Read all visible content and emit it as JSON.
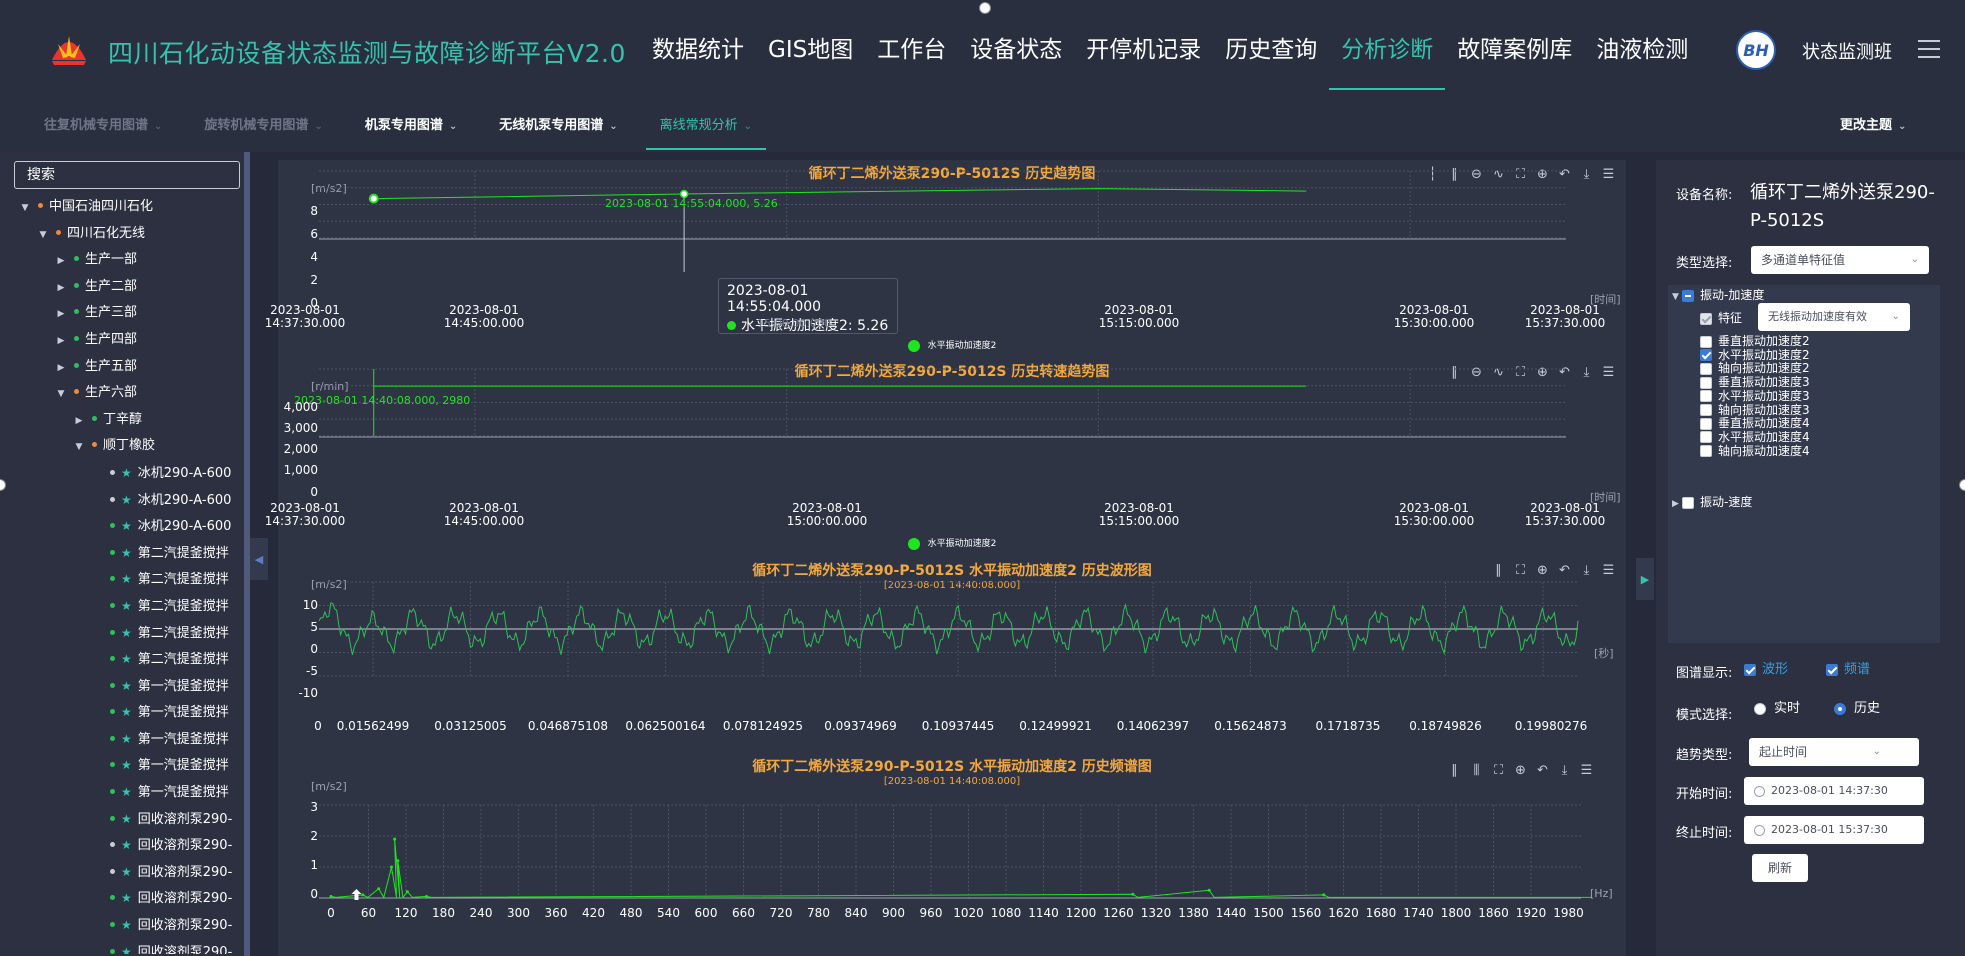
{
  "header": {
    "title": "四川石化动设备状态监测与故障诊断平台V2.0",
    "nav": [
      "数据统计",
      "GIS地图",
      "工作台",
      "设备状态",
      "开停机记录",
      "历史查询",
      "分析诊断",
      "故障案例库",
      "油液检测"
    ],
    "active_nav": "分析诊断",
    "avatar_text": "BH",
    "username": "状态监测班"
  },
  "subnav": {
    "items": [
      "往复机械专用图谱",
      "旋转机械专用图谱",
      "机泵专用图谱",
      "无线机泵专用图谱",
      "离线常规分析"
    ],
    "active": "离线常规分析",
    "theme_label": "更改主题"
  },
  "sidebar": {
    "search_placeholder": "搜索",
    "tree": [
      {
        "label": "中国石油四川石化",
        "level": 0,
        "arrow": "▼",
        "dot": "o"
      },
      {
        "label": "四川石化无线",
        "level": 1,
        "arrow": "▼",
        "dot": "o"
      },
      {
        "label": "生产一部",
        "level": 2,
        "arrow": "▶",
        "dot": "g"
      },
      {
        "label": "生产二部",
        "level": 2,
        "arrow": "▶",
        "dot": "g"
      },
      {
        "label": "生产三部",
        "level": 2,
        "arrow": "▶",
        "dot": "g"
      },
      {
        "label": "生产四部",
        "level": 2,
        "arrow": "▶",
        "dot": "g"
      },
      {
        "label": "生产五部",
        "level": 2,
        "arrow": "▶",
        "dot": "g"
      },
      {
        "label": "生产六部",
        "level": 2,
        "arrow": "▼",
        "dot": "o"
      },
      {
        "label": "丁辛醇",
        "level": 3,
        "arrow": "▶",
        "dot": "g"
      },
      {
        "label": "顺丁橡胶",
        "level": 3,
        "arrow": "▼",
        "dot": "o"
      },
      {
        "label": "冰机290-A-600",
        "level": 4,
        "dot": "w",
        "star": true
      },
      {
        "label": "冰机290-A-600",
        "level": 4,
        "dot": "w",
        "star": true
      },
      {
        "label": "冰机290-A-600",
        "level": 4,
        "dot": "g",
        "star": true
      },
      {
        "label": "第二汽提釜搅拌",
        "level": 4,
        "dot": "g",
        "star": true
      },
      {
        "label": "第二汽提釜搅拌",
        "level": 4,
        "dot": "g",
        "star": true
      },
      {
        "label": "第二汽提釜搅拌",
        "level": 4,
        "dot": "g",
        "star": true
      },
      {
        "label": "第二汽提釜搅拌",
        "level": 4,
        "dot": "g",
        "star": true
      },
      {
        "label": "第二汽提釜搅拌",
        "level": 4,
        "dot": "g",
        "star": true
      },
      {
        "label": "第一汽提釜搅拌",
        "level": 4,
        "dot": "g",
        "star": true
      },
      {
        "label": "第一汽提釜搅拌",
        "level": 4,
        "dot": "g",
        "star": true
      },
      {
        "label": "第一汽提釜搅拌",
        "level": 4,
        "dot": "g",
        "star": true
      },
      {
        "label": "第一汽提釜搅拌",
        "level": 4,
        "dot": "g",
        "star": true
      },
      {
        "label": "第一汽提釜搅拌",
        "level": 4,
        "dot": "g",
        "star": true
      },
      {
        "label": "回收溶剂泵290-",
        "level": 4,
        "dot": "g",
        "star": true
      },
      {
        "label": "回收溶剂泵290-",
        "level": 4,
        "dot": "w",
        "star": true
      },
      {
        "label": "回收溶剂泵290-",
        "level": 4,
        "dot": "w",
        "star": true
      },
      {
        "label": "回收溶剂泵290-",
        "level": 4,
        "dot": "g",
        "star": true
      },
      {
        "label": "回收溶剂泵290-",
        "level": 4,
        "dot": "g",
        "star": true
      },
      {
        "label": "回收溶剂泵290-",
        "level": 4,
        "dot": "g",
        "star": true
      }
    ]
  },
  "charts": {
    "trend": {
      "title": "循环丁二烯外送泵290-P-5012S 历史趋势图",
      "unit": "[m/s2]",
      "x_unit": "[时间]",
      "yticks": [
        "8",
        "6",
        "4",
        "2",
        "0"
      ],
      "xticks": [
        [
          "2023-08-01",
          "14:37:30.000"
        ],
        [
          "2023-08-01",
          "14:45:00.000"
        ],
        [
          "2023-08-01",
          "15:00:00.000"
        ],
        [
          "2023-08-01",
          "15:15:00.000"
        ],
        [
          "2023-08-01",
          "15:30:00.000"
        ],
        [
          "2023-08-01",
          "15:37:30.000"
        ]
      ],
      "marker_label": "2023-08-01 14:55:04.000, 5.26",
      "tooltip_time": "2023-08-01 14:55:04.000",
      "tooltip_value": "水平振动加速度2: 5.26",
      "tooltip_ghost": "15:00:00.000",
      "legend": "水平振动加速度2"
    },
    "speed": {
      "title": "循环丁二烯外送泵290-P-5012S 历史转速趋势图",
      "unit": "[r/min]",
      "x_unit": "[时间]",
      "yticks": [
        "4,000",
        "3,000",
        "2,000",
        "1,000",
        "0"
      ],
      "xticks": [
        [
          "2023-08-01",
          "14:37:30.000"
        ],
        [
          "2023-08-01",
          "14:45:00.000"
        ],
        [
          "2023-08-01",
          "15:00:00.000"
        ],
        [
          "2023-08-01",
          "15:15:00.000"
        ],
        [
          "2023-08-01",
          "15:30:00.000"
        ],
        [
          "2023-08-01",
          "15:37:30.000"
        ]
      ],
      "marker_label": "2023-08-01 14:40:08.000, 2980",
      "legend": "水平振动加速度2"
    },
    "wave": {
      "title": "循环丁二烯外送泵290-P-5012S 水平振动加速度2  历史波形图",
      "subtitle": "[2023-08-01 14:40:08.000]",
      "unit": "[m/s2]",
      "x_unit": "[秒]",
      "yticks": [
        "10",
        "5",
        "0",
        "-5",
        "-10"
      ],
      "xticks": [
        "0",
        "0.01562499",
        "0.03125005",
        "0.046875108",
        "0.062500164",
        "0.078124925",
        "0.09374969",
        "0.10937445",
        "0.12499921",
        "0.14062397",
        "0.15624873",
        "0.1718735",
        "0.18749826",
        "0.19980276"
      ]
    },
    "spectrum": {
      "title": "循环丁二烯外送泵290-P-5012S 水平振动加速度2  历史频谱图",
      "subtitle": "[2023-08-01 14:40:08.000]",
      "unit": "[m/s2]",
      "x_unit": "[Hz]",
      "yticks": [
        "3",
        "2",
        "1",
        "0"
      ],
      "xticks": [
        "0",
        "60",
        "120",
        "180",
        "240",
        "300",
        "360",
        "420",
        "480",
        "540",
        "600",
        "660",
        "720",
        "780",
        "840",
        "900",
        "960",
        "1020",
        "1080",
        "1140",
        "1200",
        "1260",
        "1320",
        "1380",
        "1440",
        "1500",
        "1560",
        "1620",
        "1680",
        "1740",
        "1800",
        "1860",
        "1920",
        "1980"
      ]
    }
  },
  "chart_data": [
    {
      "type": "line",
      "title": "循环丁二烯外送泵290-P-5012S 历史趋势图",
      "ylabel": "[m/s2]",
      "xlabel": "[时间]",
      "ylim": [
        0,
        8
      ],
      "x": [
        "2023-08-01 14:40:08",
        "2023-08-01 14:55:04",
        "2023-08-01 15:15:00",
        "2023-08-01 15:25:00"
      ],
      "series": [
        {
          "name": "水平振动加速度2",
          "values": [
            4.7,
            5.26,
            5.9,
            5.6
          ]
        }
      ]
    },
    {
      "type": "line",
      "title": "循环丁二烯外送泵290-P-5012S 历史转速趋势图",
      "ylabel": "[r/min]",
      "xlabel": "[时间]",
      "ylim": [
        0,
        4000
      ],
      "x": [
        "2023-08-01 14:40:08",
        "2023-08-01 15:25:00"
      ],
      "series": [
        {
          "name": "水平振动加速度2",
          "values": [
            2980,
            2980
          ]
        }
      ]
    },
    {
      "type": "line",
      "title": "循环丁二烯外送泵290-P-5012S 水平振动加速度2  历史波形图",
      "ylabel": "[m/s2]",
      "xlabel": "[秒]",
      "xlim": [
        0,
        0.19980276
      ],
      "ylim": [
        -10,
        10
      ]
    },
    {
      "type": "line",
      "title": "循环丁二烯外送泵290-P-5012S 水平振动加速度2  历史频谱图",
      "ylabel": "[m/s2]",
      "xlabel": "[Hz]",
      "xlim": [
        0,
        1980
      ],
      "ylim": [
        0,
        3
      ],
      "x": [
        0,
        50,
        75,
        95,
        100,
        105,
        120,
        150,
        1260,
        1380,
        1560
      ],
      "values": [
        0.05,
        0.1,
        0.3,
        1.0,
        1.9,
        1.2,
        0.2,
        0.05,
        0.12,
        0.25,
        0.1
      ]
    }
  ],
  "right_panel": {
    "device_label": "设备名称:",
    "device_name": "循环丁二烯外送泵290-P-5012S",
    "type_label": "类型选择:",
    "type_value": "多通道单特征值",
    "group1": "振动-加速度",
    "feature_label": "特征",
    "feature_value": "无线振动加速度有效",
    "channels": [
      {
        "label": "垂直振动加速度2",
        "checked": false
      },
      {
        "label": "水平振动加速度2",
        "checked": true
      },
      {
        "label": "轴向振动加速度2",
        "checked": false
      },
      {
        "label": "垂直振动加速度3",
        "checked": false
      },
      {
        "label": "水平振动加速度3",
        "checked": false
      },
      {
        "label": "轴向振动加速度3",
        "checked": false
      },
      {
        "label": "垂直振动加速度4",
        "checked": false
      },
      {
        "label": "水平振动加速度4",
        "checked": false
      },
      {
        "label": "轴向振动加速度4",
        "checked": false
      }
    ],
    "group2": "振动-速度",
    "display_label": "图谱显示:",
    "display_wave": "波形",
    "display_spectrum": "频谱",
    "mode_label": "模式选择:",
    "mode_realtime": "实时",
    "mode_history": "历史",
    "trend_label": "趋势类型:",
    "trend_value": "起止时间",
    "start_label": "开始时间:",
    "start_value": "2023-08-01 14:37:30",
    "end_label": "终止时间:",
    "end_value": "2023-08-01 15:37:30",
    "refresh": "刷新"
  },
  "colors": {
    "accent": "#34c3ad",
    "title_orange": "#f4a83a",
    "series_green": "#1ee61e",
    "checkbox_blue": "#3a7bd5"
  }
}
